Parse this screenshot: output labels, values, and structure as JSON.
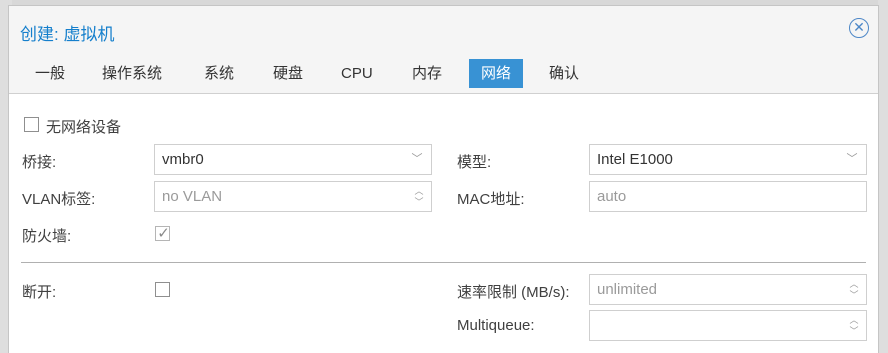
{
  "window": {
    "title": "创建: 虚拟机",
    "close_icon": "close-circle-icon"
  },
  "tabs": [
    {
      "label": "一般",
      "active": false
    },
    {
      "label": "操作系统",
      "active": false
    },
    {
      "label": "系统",
      "active": false
    },
    {
      "label": "硬盘",
      "active": false
    },
    {
      "label": "CPU",
      "active": false
    },
    {
      "label": "内存",
      "active": false
    },
    {
      "label": "网络",
      "active": true
    },
    {
      "label": "确认",
      "active": false
    }
  ],
  "network": {
    "no_network_device": {
      "label": "无网络设备",
      "checked": false
    },
    "bridge": {
      "label": "桥接:",
      "value": "vmbr0"
    },
    "model": {
      "label": "模型:",
      "value": "Intel E1000"
    },
    "vlan_tag": {
      "label": "VLAN标签:",
      "placeholder": "no VLAN"
    },
    "mac_address": {
      "label": "MAC地址:",
      "placeholder": "auto"
    },
    "firewall": {
      "label": "防火墙:",
      "checked": true,
      "disabled": true
    },
    "disconnect": {
      "label": "断开:",
      "checked": false
    },
    "rate_limit": {
      "label": "速率限制 (MB/s):",
      "placeholder": "unlimited"
    },
    "multiqueue": {
      "label": "Multiqueue:",
      "value": ""
    }
  },
  "colors": {
    "accent": "#157fcc",
    "active_tab": "#3892d4"
  }
}
